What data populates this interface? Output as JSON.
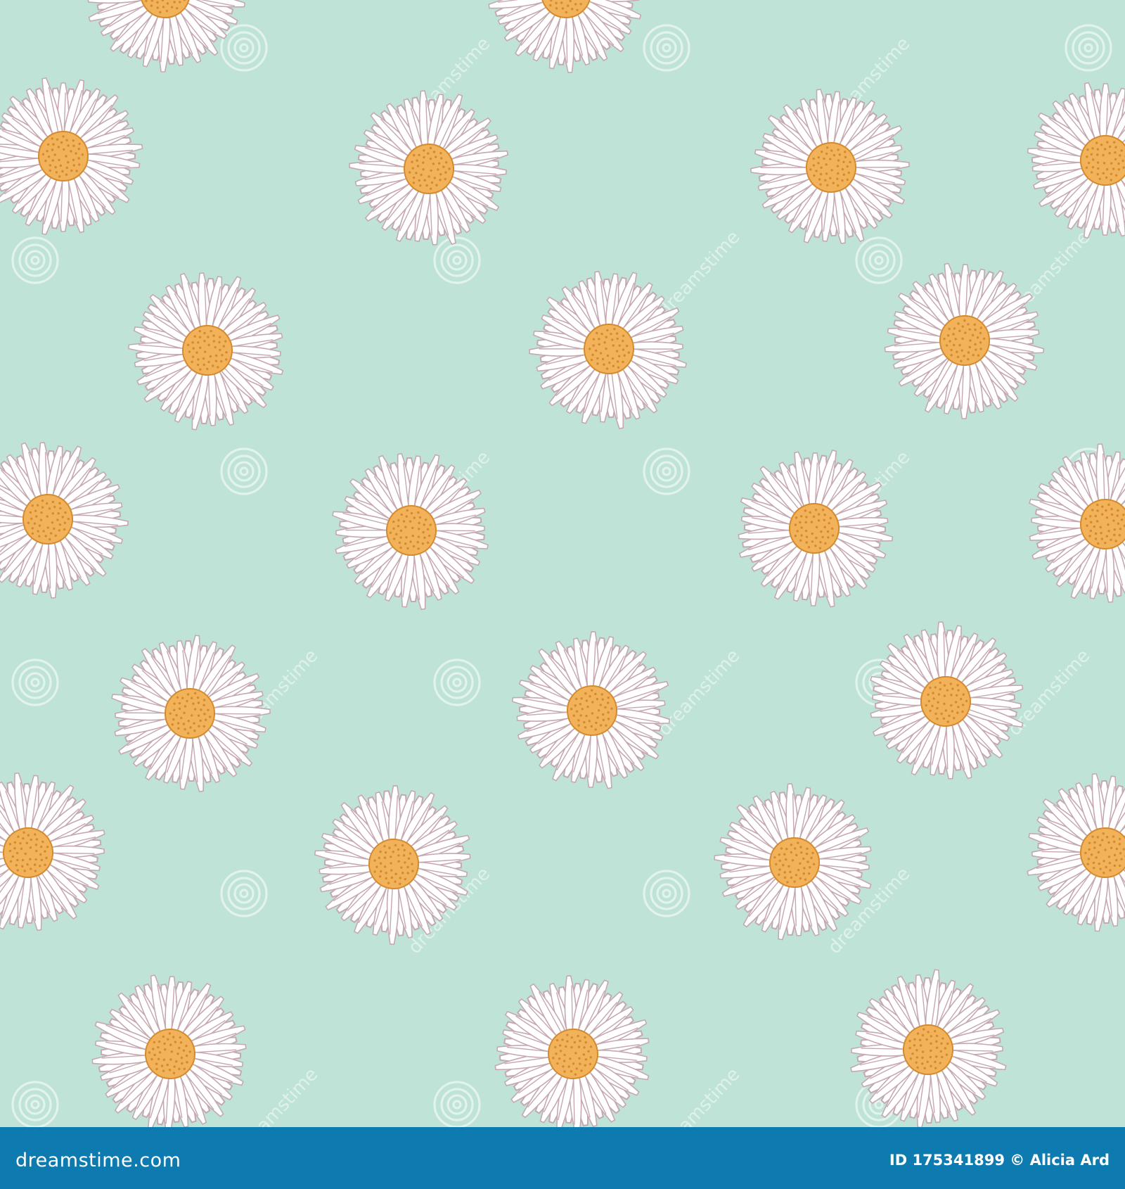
{
  "image": {
    "subject": "daisy",
    "colors": {
      "background": "#bfe3d7",
      "petal_fill": "#ffffff",
      "petal_line": "#c5a8b0",
      "center": "#f2b259",
      "center_dots": "#d48a2e",
      "watermark": "#ffffff",
      "footer_bar": "#0d7bb0",
      "footer_text": "#ffffff"
    },
    "watermark_text": "dreamstime"
  },
  "footer": {
    "logo_text": "dreamstime.com",
    "credit_text": "ID 175341899 © Alicia Ard"
  }
}
